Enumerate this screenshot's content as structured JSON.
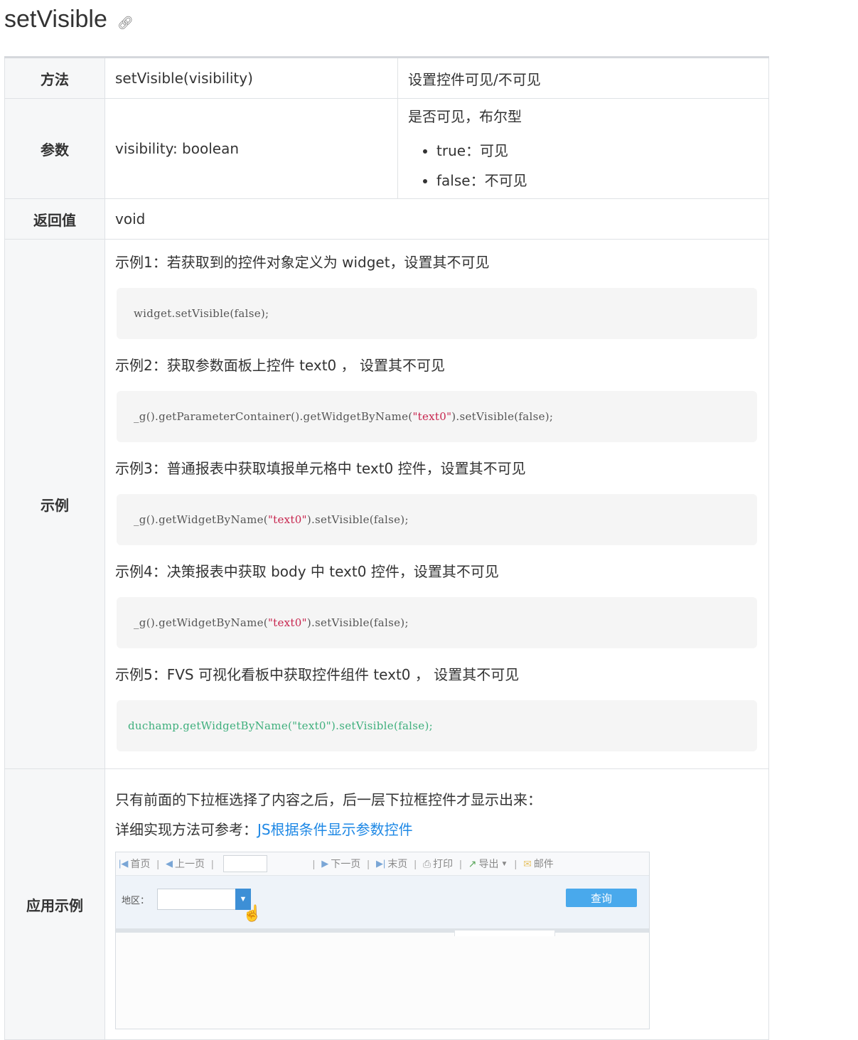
{
  "page": {
    "title": "setVisible",
    "link_icon": "link-icon"
  },
  "table": {
    "method": {
      "label": "方法",
      "signature": "setVisible(visibility)",
      "description": "设置控件可见/不可见"
    },
    "params": {
      "label": "参数",
      "signature": "visibility: boolean",
      "description": "是否可见，布尔型",
      "options": [
        "true：可见",
        "false：不可见"
      ]
    },
    "return_value": {
      "label": "返回值",
      "value": "void"
    },
    "examples": {
      "label": "示例",
      "items": [
        {
          "text": "示例1：若获取到的控件对象定义为 widget，设置其不可见",
          "code_pre": "widget.setVisible(false);",
          "code_str": "",
          "code_post": ""
        },
        {
          "text": "示例2：获取参数面板上控件 text0 ， 设置其不可见",
          "code_pre": "_g().getParameterContainer().getWidgetByName(",
          "code_str": "\"text0\"",
          "code_post": ").setVisible(false);"
        },
        {
          "text": "示例3：普通报表中获取填报单元格中 text0 控件，设置其不可见",
          "code_pre": "_g().getWidgetByName(",
          "code_str": "\"text0\"",
          "code_post": ").setVisible(false);"
        },
        {
          "text": "示例4：决策报表中获取 body 中 text0 控件，设置其不可见",
          "code_pre": "_g().getWidgetByName(",
          "code_str": "\"text0\"",
          "code_post": ").setVisible(false);"
        },
        {
          "text": "示例5：FVS 可视化看板中获取控件组件 text0 ， 设置其不可见",
          "code_pre": "duchamp.getWidgetByName(\"text0\").setVisible(false);",
          "code_str": "",
          "code_post": ""
        }
      ]
    },
    "app_example": {
      "label": "应用示例",
      "line1": "只有前面的下拉框选择了内容之后，后一层下拉框控件才显示出来：",
      "line2_prefix": "详细实现方法可参考：",
      "line2_link": "JS根据条件显示参数控件",
      "screenshot": {
        "toolbar": {
          "first": "首页",
          "prev": "上一页",
          "next": "下一页",
          "last": "末页",
          "print": "打印",
          "export": "导出",
          "mail": "邮件"
        },
        "region_label": "地区：",
        "query_button": "查询"
      }
    }
  }
}
